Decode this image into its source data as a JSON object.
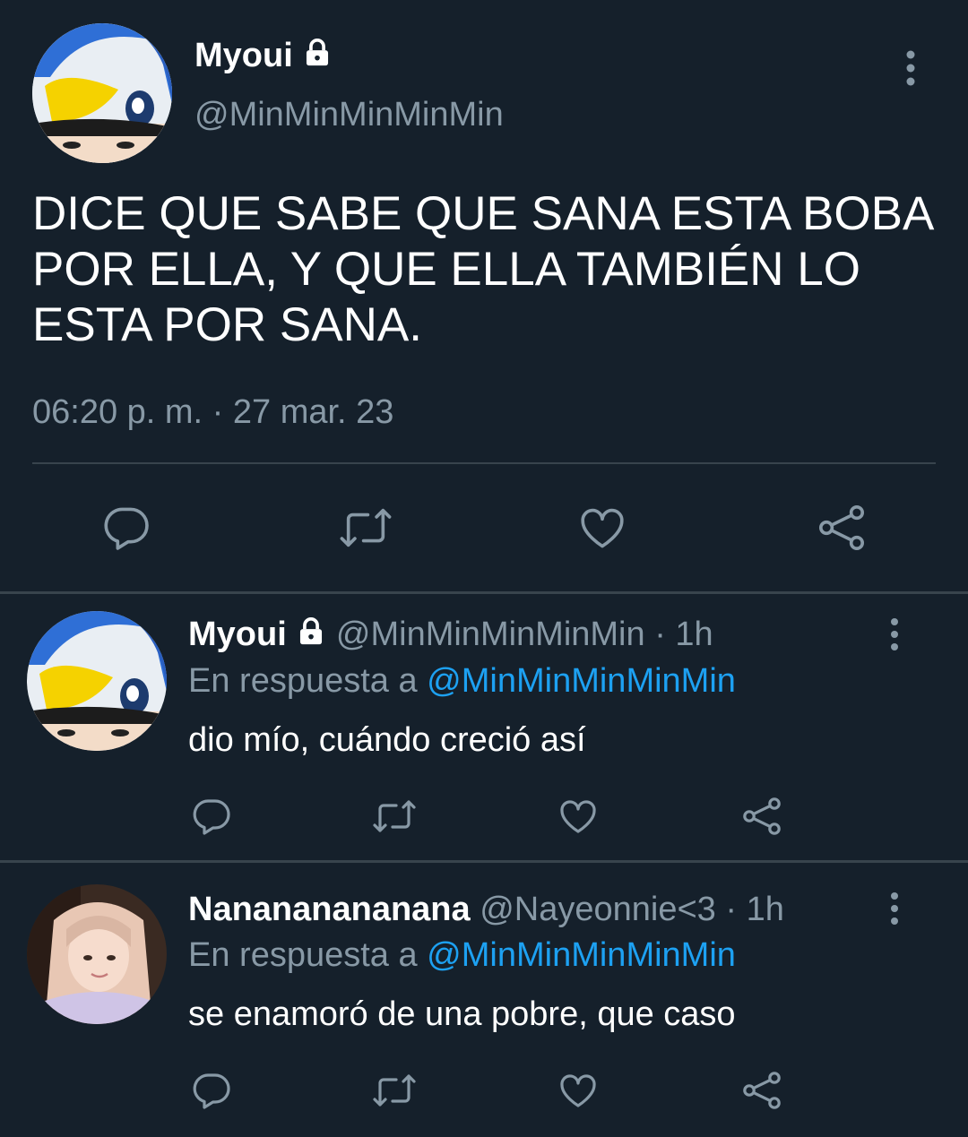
{
  "main_tweet": {
    "author_name": "Myoui",
    "author_handle": "@MinMinMinMinMin",
    "text_line1": "DICE QUE SABE QUE SANA ESTA BOBA",
    "text_line2": "POR ELLA, Y QUE ELLA TAMBIÉN LO",
    "text_line3": "ESTA POR SANA.",
    "timestamp": "06:20 p. m. · 27 mar. 23"
  },
  "replies": [
    {
      "author_name": "Myoui",
      "author_handle": "@MinMinMinMinMin",
      "time": "· 1h",
      "reply_prefix": "En respuesta a",
      "reply_to": "@MinMinMinMinMin",
      "text": "dio mío, cuándo creció así"
    },
    {
      "author_name": "Nanananananana",
      "author_handle": "@Nayeonnie<3",
      "time": "· 1h",
      "reply_prefix": "En respuesta a",
      "reply_to": "@MinMinMinMinMin",
      "text": "se enamoró de una pobre, que caso"
    }
  ],
  "colors": {
    "background": "#15202b",
    "muted": "#8899a6",
    "link": "#1da1f2",
    "divider": "#38444d"
  },
  "icons": [
    "more-vert-icon",
    "lock-icon",
    "reply-icon",
    "retweet-icon",
    "like-icon",
    "share-icon"
  ]
}
